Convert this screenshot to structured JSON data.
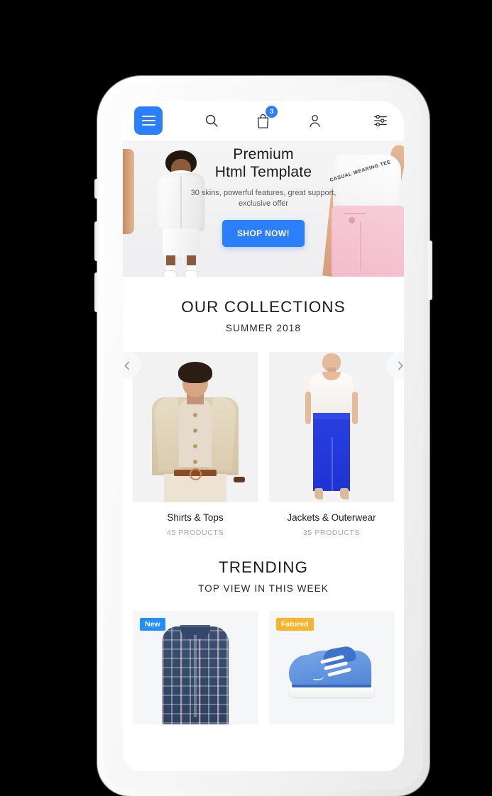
{
  "header": {
    "menu_icon": "hamburger-menu-icon",
    "search_icon": "search-icon",
    "cart_icon": "shopping-bag-icon",
    "cart_count": "3",
    "account_icon": "user-account-icon",
    "settings_icon": "filter-sliders-icon",
    "accent_color": "#2b7ffb"
  },
  "hero": {
    "title_line1": "Premium",
    "title_line2": "Html Template",
    "subtitle": "30 skins, powerful features, great support, exclusive offer",
    "cta_label": "SHOP NOW!",
    "cta_color": "#2b7ffb",
    "tee_print_text": "CASUAL WEARING TEE"
  },
  "collections": {
    "title": "OUR COLLECTIONS",
    "subtitle": "SUMMER 2018",
    "prev_icon": "chevron-left-icon",
    "next_icon": "chevron-right-icon",
    "items": [
      {
        "name": "Shirts & Tops",
        "count": "45 PRODUCTS",
        "image_alt": "man-in-beige-cardigan"
      },
      {
        "name": "Jackets & Outerwear",
        "count": "35 PRODUCTS",
        "image_alt": "woman-in-white-tee-blue-jeans"
      }
    ]
  },
  "trending": {
    "title": "TRENDING",
    "subtitle": "TOP VIEW IN THIS WEEK",
    "items": [
      {
        "badge": "New",
        "badge_color": "#1f8fff",
        "image_alt": "blue-plaid-shirt"
      },
      {
        "badge": "Fatured",
        "badge_color": "#fbb429",
        "image_alt": "blue-canvas-sneaker"
      }
    ]
  }
}
